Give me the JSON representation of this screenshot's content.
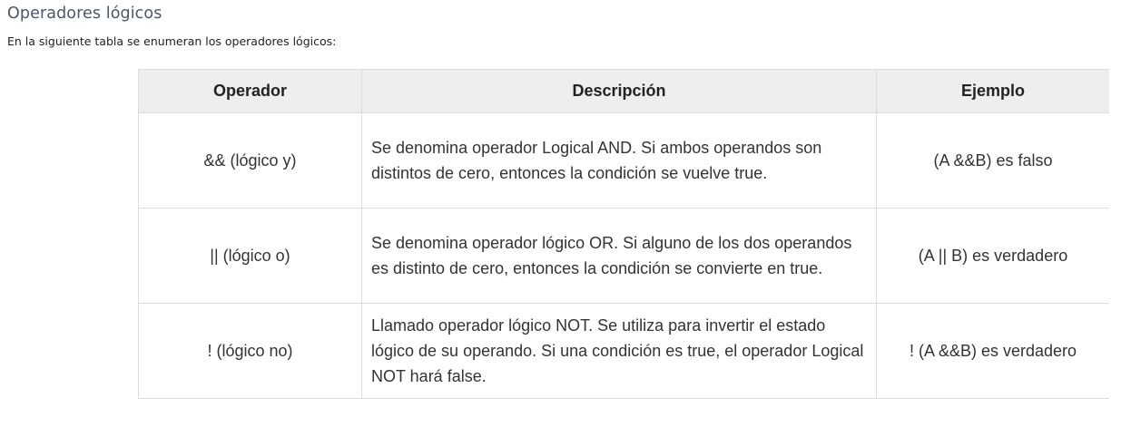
{
  "page": {
    "title": "Operadores lógicos",
    "intro": "En la siguiente tabla se enumeran los operadores lógicos:"
  },
  "table": {
    "headers": [
      "Operador",
      "Descripción",
      "Ejemplo"
    ],
    "rows": [
      {
        "operator": "&& (lógico y)",
        "description": "Se denomina operador Logical AND. Si ambos operandos son distintos de cero, entonces la condición se vuelve true.",
        "example": "(A &&B) es falso"
      },
      {
        "operator": "|| (lógico o)",
        "description": "Se denomina operador lógico OR. Si alguno de los dos operandos es distinto de cero, entonces la condición se convierte en true.",
        "example": "(A || B) es verdadero"
      },
      {
        "operator": "! (lógico no)",
        "description": "Llamado operador lógico NOT. Se utiliza para invertir el estado lógico de su operando. Si una condición es true, el operador Logical NOT hará false.",
        "example": "! (A &&B) es verdadero"
      }
    ]
  },
  "colors": {
    "title": "#4a5868",
    "header_background": "#eeeeee",
    "border": "#dcdcdc",
    "text": "#333333"
  }
}
